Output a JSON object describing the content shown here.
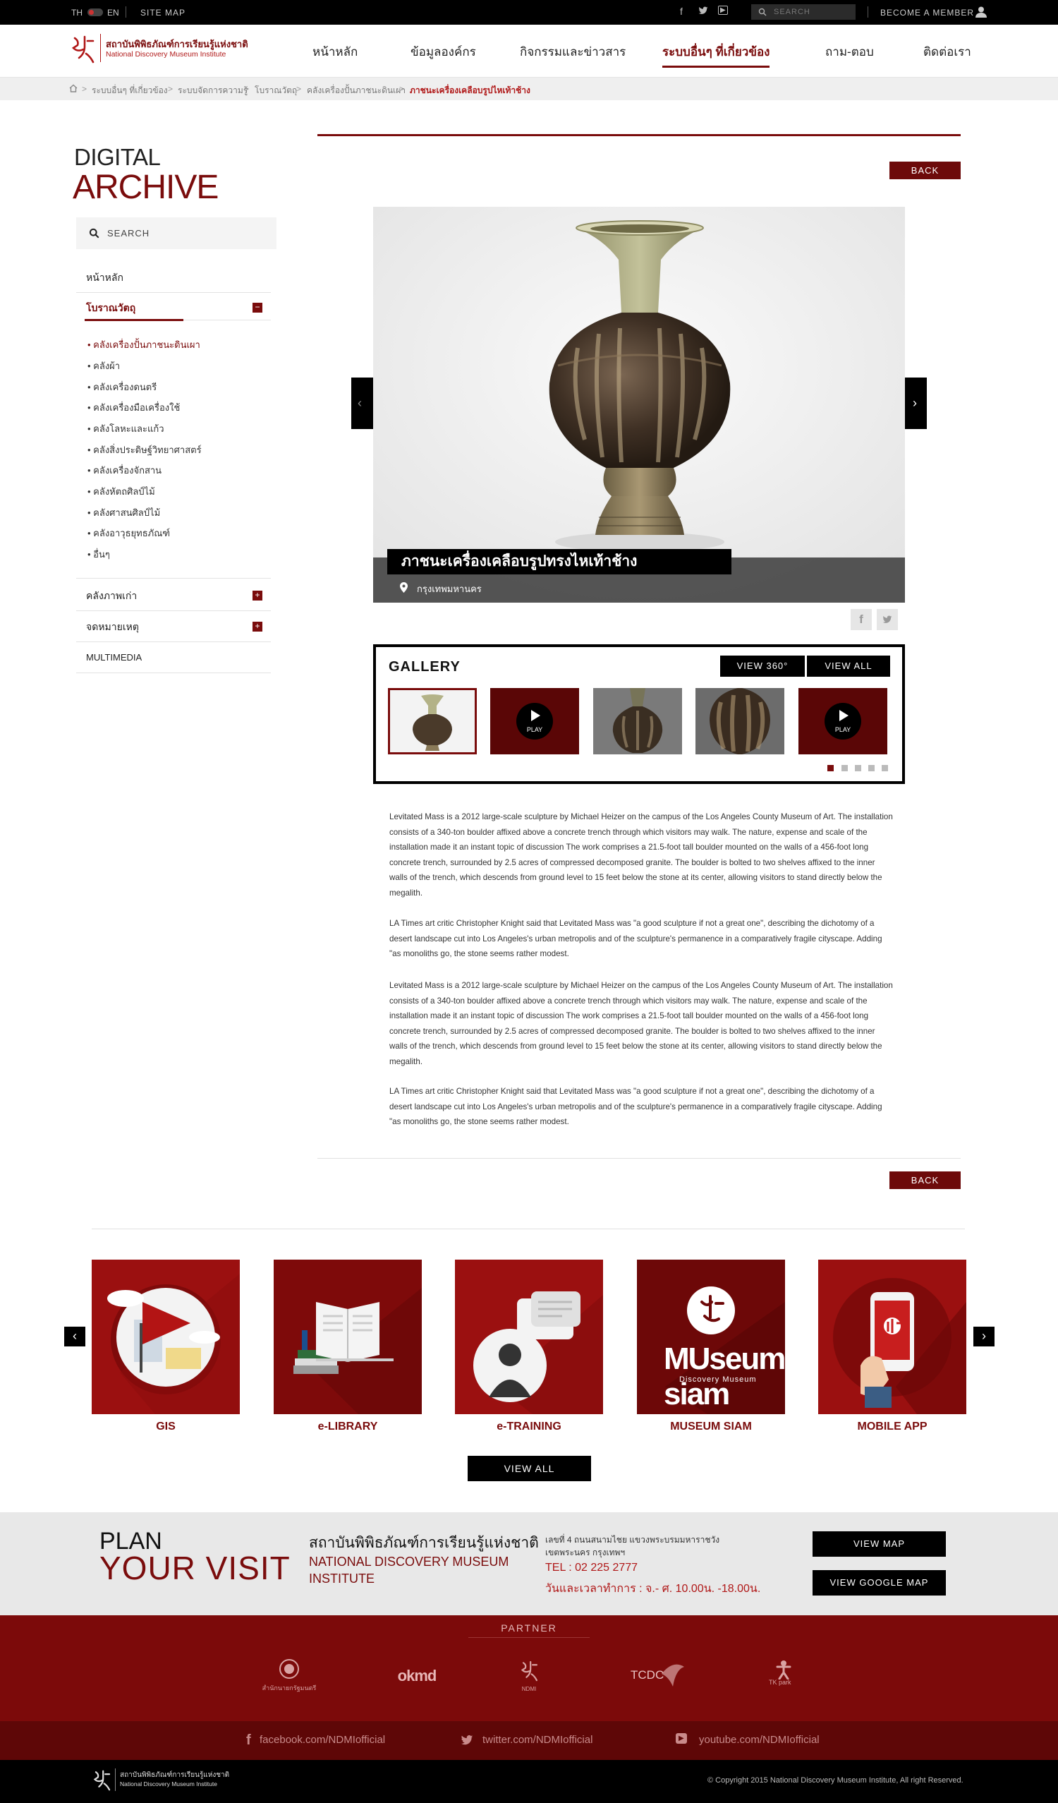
{
  "topbar": {
    "lang_th": "TH",
    "lang_en": "EN",
    "site_map": "SITE MAP",
    "search_placeholder": "SEARCH",
    "member": "BECOME A MEMBER"
  },
  "brand": {
    "name_th": "สถาบันพิพิธภัณฑ์การเรียนรู้แห่งชาติ",
    "name_en": "National Discovery Museum Institute"
  },
  "nav": {
    "items": [
      {
        "label": "หน้าหลัก"
      },
      {
        "label": "ข้อมูลองค์กร"
      },
      {
        "label": "กิจกรรมและข่าวสาร"
      },
      {
        "label": "ระบบอื่นๆ ที่เกี่ยวข้อง"
      },
      {
        "label": "ถาม-ตอบ"
      },
      {
        "label": "ติดต่อเรา"
      }
    ]
  },
  "breadcrumb": [
    "ระบบอื่นๆ ที่เกี่ยวข้อง",
    "ระบบจัดการความรู้",
    "โบราณวัตถุ",
    "คลังเครื่องปั้นภาชนะดินเผา",
    "ภาชนะเครื่องเคลือบรูปไหเท้าช้าง"
  ],
  "sidebar": {
    "title_line1": "DIGITAL",
    "title_line2": "ARCHIVE",
    "search_placeholder": "SEARCH",
    "home": "หน้าหลัก",
    "section_active": "โบราณวัตถุ",
    "sub_items": [
      "คลังเครื่องปั้นภาชนะดินเผา",
      "คลังผ้า",
      "คลังเครื่องดนตรี",
      "คลังเครื่องมือเครื่องใช้",
      "คลังโลหะและแก้ว",
      "คลังสิ่งประดิษฐ์วิทยาศาสตร์",
      "คลังเครื่องจักสาน",
      "คลังหัตถศิลป์ไม้",
      "คลังศาสนศิลป์ไม้",
      "คลังอาวุธยุทธภัณฑ์",
      "อื่นๆ"
    ],
    "section_photos": "คลังภาพเก่า",
    "section_archives": "จดหมายเหตุ",
    "section_multimedia": "MULTIMEDIA"
  },
  "article": {
    "back_label": "BACK",
    "title": "ภาชนะเครื่องเคลือบรูปทรงไหเท้าช้าง",
    "location": "กรุงเทพมหานคร",
    "gallery_title": "GALLERY",
    "view_360": "VIEW 360°",
    "view_all": "VIEW ALL",
    "play_label": "PLAY",
    "paragraphs": [
      "Levitated Mass is a 2012 large-scale sculpture by Michael Heizer on the campus of the Los Angeles County Museum of Art. The installation consists of a 340-ton boulder affixed above a concrete trench through which visitors may walk. The nature, expense and scale of the installation made it an instant topic of discussion The work comprises a 21.5-foot tall boulder mounted on the walls of a 456-foot long concrete trench, surrounded by 2.5 acres of compressed decomposed granite. The boulder is bolted to two shelves affixed to the inner walls of the trench, which descends from ground level to 15 feet below the stone at its center, allowing visitors to stand directly below the megalith.",
      "LA Times art critic Christopher Knight said that Levitated Mass was \"a good sculpture if not a great one\", describing the dichotomy of a desert landscape cut into Los Angeles's urban metropolis and of the sculpture's permanence in a comparatively fragile cityscape. Adding \"as monoliths go, the stone seems rather modest.",
      "Levitated Mass is a 2012 large-scale sculpture by Michael Heizer on the campus of the Los Angeles County Museum of Art. The installation consists of a 340-ton boulder affixed above a concrete trench through which visitors may walk. The nature, expense and scale of the installation made it an instant topic of discussion The work comprises a 21.5-foot tall boulder mounted on the walls of a 456-foot long concrete trench, surrounded by 2.5 acres of compressed decomposed granite. The boulder is bolted to two shelves affixed to the inner walls of the trench, which descends from ground level to 15 feet below the stone at its center, allowing visitors to stand directly below the megalith.",
      "LA Times art critic Christopher Knight said that Levitated Mass was \"a good sculpture if not a great one\", describing the dichotomy of a desert landscape cut into Los Angeles's urban metropolis and of the sculpture's permanence in a comparatively fragile cityscape. Adding \"as monoliths go, the stone seems rather modest."
    ]
  },
  "services": {
    "tiles": [
      {
        "label": "GIS"
      },
      {
        "label": "e-LIBRARY"
      },
      {
        "label": "e-TRAINING"
      },
      {
        "label": "MUSEUM SIAM"
      },
      {
        "label": "MOBILE APP"
      }
    ],
    "view_all": "VIEW ALL",
    "museum_logo_text": "MUseum siam",
    "museum_logo_sub": "Discovery Museum"
  },
  "visit": {
    "plan": "PLAN",
    "your_visit": "YOUR VISIT",
    "org_th": "สถาบันพิพิธภัณฑ์การเรียนรู้แห่งชาติ",
    "org_en_1": "NATIONAL DISCOVERY MUSEUM",
    "org_en_2": "INSTITUTE",
    "address_1": "เลขที่ 4 ถนนสนามไชย แขวงพระบรมมหาราชวัง",
    "address_2": "เขตพระนคร กรุงเทพฯ",
    "tel": "TEL : 02 225 2777",
    "hours": "วันและเวลาทำการ : จ.- ศ. 10.00น. -18.00น.",
    "view_map": "VIEW MAP",
    "view_google_map": "VIEW GOOGLE MAP"
  },
  "partner": {
    "title": "PARTNER",
    "logos": [
      "สำนักนายกรัฐมนตรี",
      "okmd",
      "NDMI",
      "TCDC",
      "TK park"
    ]
  },
  "social": {
    "facebook": "facebook.com/NDMIofficial",
    "twitter": "twitter.com/NDMIofficial",
    "youtube": "youtube.com/NDMIofficial"
  },
  "footer": {
    "copyright": "Copyright 2015 National Discovery Museum Institute, All right Reserved."
  },
  "colors": {
    "brand_red": "#7a0c0c",
    "dark_red": "#6d0a0a",
    "footer_black": "#000000"
  }
}
